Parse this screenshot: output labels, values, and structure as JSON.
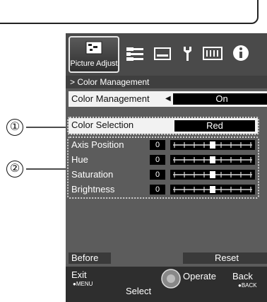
{
  "tabs": {
    "picture_adjust_label": "Picture Adjust",
    "icons": [
      "picture-adjust-icon",
      "input-settings-icon",
      "display-setup-icon",
      "installation-icon",
      "function-icon",
      "information-icon"
    ]
  },
  "breadcrumb": "> Color Management",
  "color_management": {
    "label": "Color Management",
    "arrow": "◀",
    "value": "On"
  },
  "color_selection": {
    "label": "Color Selection",
    "value": "Red"
  },
  "params": [
    {
      "label": "Axis Position",
      "value": "0",
      "level": 0.5
    },
    {
      "label": "Hue",
      "value": "0",
      "level": 0.5
    },
    {
      "label": "Saturation",
      "value": "0",
      "level": 0.5
    },
    {
      "label": "Brightness",
      "value": "0",
      "level": 0.5
    }
  ],
  "buttons": {
    "before": "Before",
    "reset": "Reset"
  },
  "footer": {
    "exit": "Exit",
    "exit_key": "●MENU",
    "select": "Select",
    "operate": "Operate",
    "back": "Back",
    "back_key": "●BACK"
  },
  "callouts": {
    "one": "①",
    "two": "②"
  },
  "colors": {
    "panel": "#5c5c5c",
    "highlight": "#f2f2f2",
    "value_box": "#000000"
  }
}
